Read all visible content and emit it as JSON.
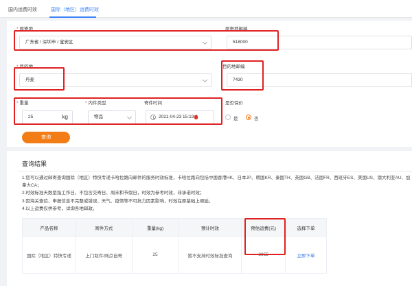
{
  "tabs": [
    {
      "label": "国内运费时效"
    },
    {
      "label": "国际（地区）运费时效"
    }
  ],
  "form": {
    "origin": {
      "label": "原寄地",
      "value": "广东省 / 深圳市 / 宝安区"
    },
    "origin_postcode": {
      "label": "原寄地邮编",
      "value": "518000"
    },
    "destination": {
      "label": "目的地",
      "value": "丹麦"
    },
    "destination_postcode": {
      "label": "目的地邮编",
      "value": "7430"
    },
    "weight": {
      "label": "重量",
      "value": "25",
      "unit": "kg"
    },
    "content_type": {
      "label": "内件类型",
      "value": "物品"
    },
    "send_time": {
      "label": "寄件时间",
      "value": "2021-04-23 15:19:0"
    },
    "insured": {
      "label": "是否保价",
      "options": [
        {
          "label": "是",
          "selected": false
        },
        {
          "label": "否",
          "selected": true
        }
      ]
    },
    "query_button": "查询"
  },
  "result": {
    "title": "查询结果",
    "notes": [
      "1.您可以通过邮寄查询国际（地区）特快专递卡哈拉路向邮件的服务时效标准，卡哈拉路向包括中国香港HK、日本JP、韩国KR、泰国TH、英国GB、法国FR、西班牙ES、美国US、澳大利亚AU、加",
      "拿大CA；",
      "2.时效标准天数是指工作日，不包含交寄日、周末和节假日，时效为参考时效，非承诺时效；",
      "3.因海关查验、申报信息不完整或错误、天气、疫情等不可抗力因素影响，时效在原基础上顺延。",
      "4.以上运费仅供参考，详询各地邮政。"
    ],
    "table": {
      "headers": [
        "产品名称",
        "寄件方式",
        "重量(kg)",
        "预计时效",
        "预估运费(元)",
        "选择下单"
      ],
      "rows": [
        [
          "国际（地区）特快专递",
          "上门取件/网点自寄",
          "25",
          "暂不支持时效标准查询",
          "3955",
          "立即下单"
        ]
      ]
    }
  },
  "colors": {
    "accent": "#f27d16",
    "link": "#2f74e6",
    "annotation": "#e02020",
    "tab_active": "#3a82f7"
  }
}
